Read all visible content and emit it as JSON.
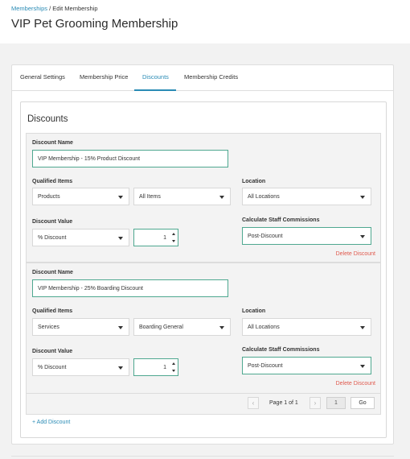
{
  "breadcrumb": {
    "parent": "Memberships",
    "separator": " / ",
    "current": "Edit Membership"
  },
  "page_title": "VIP Pet Grooming Membership",
  "tabs": [
    {
      "label": "General Settings",
      "active": false
    },
    {
      "label": "Membership Price",
      "active": false
    },
    {
      "label": "Discounts",
      "active": true
    },
    {
      "label": "Membership Credits",
      "active": false
    }
  ],
  "section_title": "Discounts",
  "labels": {
    "discount_name": "Discount Name",
    "qualified_items": "Qualified Items",
    "location": "Location",
    "discount_value": "Discount Value",
    "staff_commissions": "Calculate Staff Commissions",
    "delete": "Delete Discount"
  },
  "discounts": [
    {
      "name": "VIP Membership - 15% Product Discount",
      "item_type": "Products",
      "item_scope": "All Items",
      "location": "All Locations",
      "value_type": "% Discount",
      "value": "1",
      "commission": "Post-Discount"
    },
    {
      "name": "VIP Membership - 25% Boarding Discount",
      "item_type": "Services",
      "item_scope": "Boarding General",
      "location": "All Locations",
      "value_type": "% Discount",
      "value": "1",
      "commission": "Post-Discount"
    }
  ],
  "pagination": {
    "prev": "‹",
    "next": "›",
    "text": "Page 1 of 1",
    "page_value": "1",
    "go_label": "Go"
  },
  "add_discount_label": "+ Add Discount",
  "colors": {
    "accent": "#2a8bb5",
    "focus_border": "#4fa890",
    "danger": "#e05a4e"
  }
}
